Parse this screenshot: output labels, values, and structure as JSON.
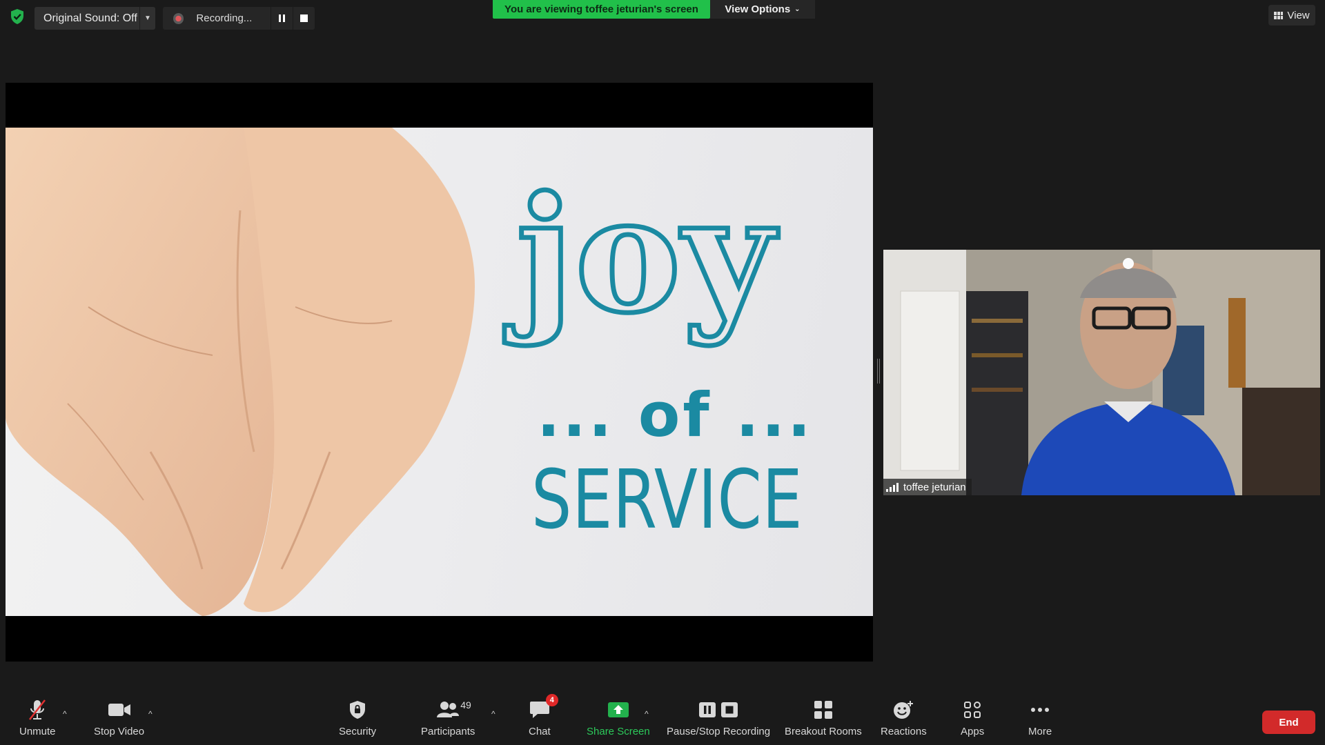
{
  "top_bar": {
    "original_sound_label": "Original Sound: Off",
    "recording_label": "Recording...",
    "viewing_banner": "You are viewing toffee jeturian's screen",
    "view_options_label": "View Options",
    "view_label": "View"
  },
  "shared_screen": {
    "slide_word_1": "joy",
    "slide_word_2": "... of ...",
    "slide_word_3": "SERVICE"
  },
  "participant": {
    "name": "toffee jeturian"
  },
  "toolbar": {
    "unmute": "Unmute",
    "stop_video": "Stop Video",
    "security": "Security",
    "participants": "Participants",
    "participants_count": "49",
    "chat": "Chat",
    "chat_badge": "4",
    "share_screen": "Share Screen",
    "pause_stop_recording": "Pause/Stop Recording",
    "breakout_rooms": "Breakout Rooms",
    "reactions": "Reactions",
    "apps": "Apps",
    "more": "More",
    "end": "End"
  },
  "colors": {
    "accent_green": "#21c04a",
    "end_red": "#d22a2a",
    "slide_teal": "#1b8aa2",
    "badge_red": "#e02828"
  }
}
